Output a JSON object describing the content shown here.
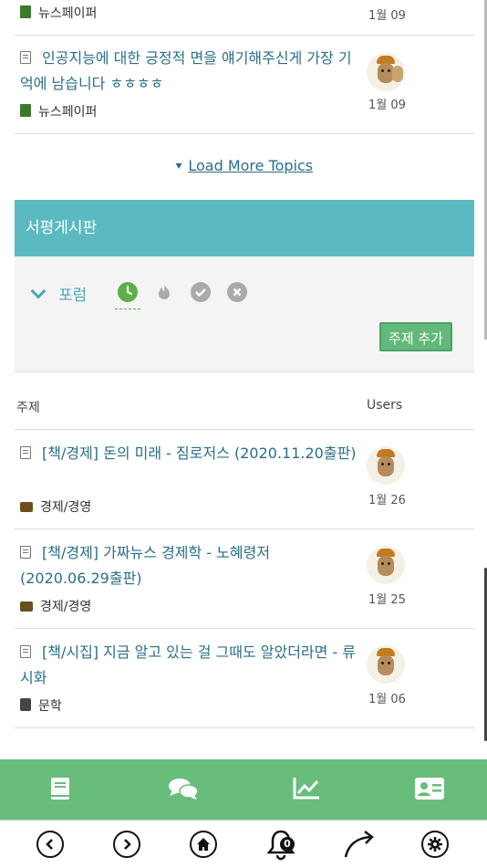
{
  "top_topics": [
    {
      "category": "뉴스페이퍼",
      "date": "1월 09"
    },
    {
      "title": "인공지능에 대한 긍정적 면을 얘기해주신게 가장 기억에 남습니다 ㅎㅎㅎㅎ",
      "category": "뉴스페이퍼",
      "date": "1월 09"
    }
  ],
  "load_more": "Load More Topics",
  "board": {
    "title": "서평게시판",
    "forum_label": "포럼",
    "add_topic": "주제 추가"
  },
  "headers": {
    "topic": "주제",
    "users": "Users"
  },
  "topics": [
    {
      "title": "[책/경제] 돈의 미래 - 짐로저스 (2020.11.20출판)",
      "category": "경제/경영",
      "date": "1월 26"
    },
    {
      "title": "[책/경제] 가짜뉴스 경제학 - 노혜령저 (2020.06.29출판)",
      "category": "경제/경영",
      "date": "1월 25"
    },
    {
      "title": "[책/시집] 지금 알고 있는 걸 그때도 알았더라면 - 류시화",
      "category": "문학",
      "date": "1월 06"
    }
  ],
  "bottom_nav": {
    "notification_count": "0"
  },
  "icons": {
    "filters": [
      "latest-clock-icon",
      "hot-flame-icon",
      "solved-check-icon",
      "unsolved-x-icon"
    ],
    "nav": [
      "book-icon",
      "chat-icon",
      "chart-icon",
      "profile-card-icon"
    ],
    "system": [
      "back-icon",
      "forward-icon",
      "home-icon",
      "bell-icon",
      "share-icon",
      "settings-icon"
    ]
  },
  "colors": {
    "accent": "#5bb9c2",
    "green": "#68bd7a",
    "link": "#2a6e8a"
  }
}
